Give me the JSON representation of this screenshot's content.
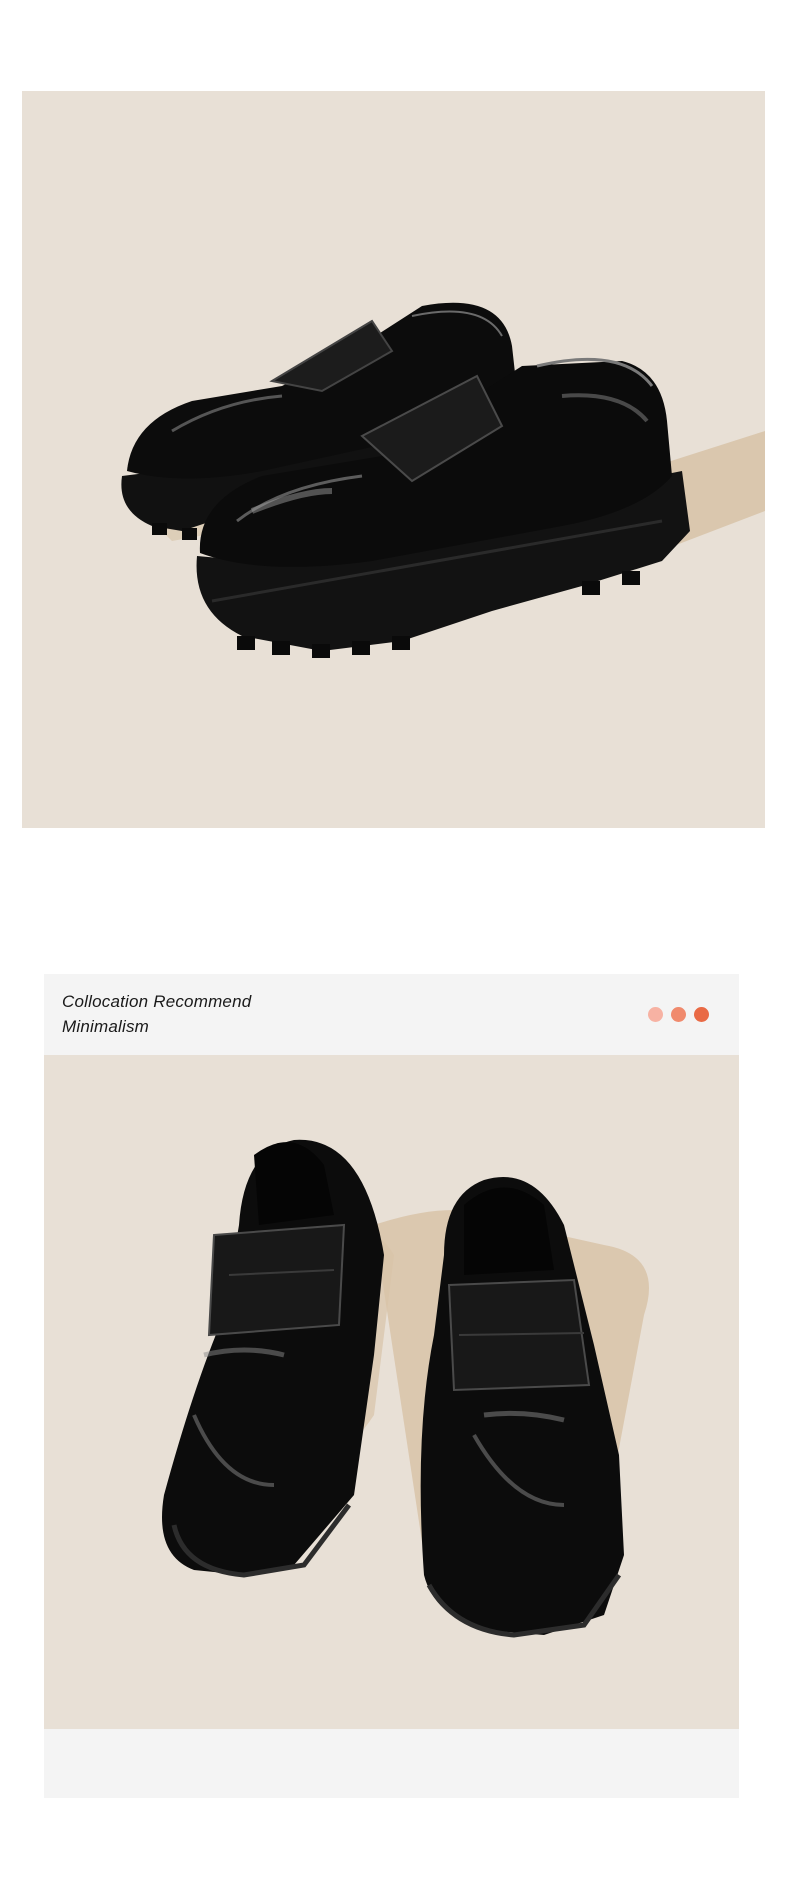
{
  "photo_top": {
    "alt_icon": "loafers-side-view-icon"
  },
  "card": {
    "title_line1": "Collocation Recommend",
    "title_line2": "Minimalism",
    "dots": [
      {
        "color": "#f7b2a3"
      },
      {
        "color": "#f08a6d"
      },
      {
        "color": "#e96a45"
      }
    ]
  },
  "colors": {
    "background": "#ffffff",
    "photo_bg": "#e8e0d6",
    "shadow": "#d8c3a8",
    "card_bg": "#f4f4f4",
    "shoe": "#0d0d0d"
  }
}
